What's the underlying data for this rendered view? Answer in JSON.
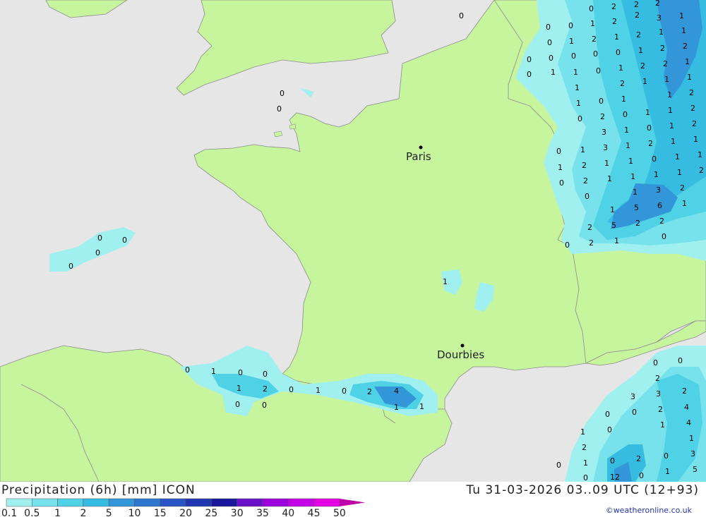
{
  "header": {
    "title": "Precipitation (6h) [mm] ICON",
    "datetime": "Tu 31-03-2026 03..09 UTC (12+93)",
    "credit": "©weatheronline.co.uk"
  },
  "cities": [
    {
      "name": "Paris"
    },
    {
      "name": "Dourbies"
    }
  ],
  "legend": {
    "labels": [
      "0.1",
      "0.5",
      "1",
      "2",
      "5",
      "10",
      "15",
      "20",
      "25",
      "30",
      "35",
      "40",
      "45",
      "50"
    ],
    "colors": [
      "#a0f0f0",
      "#78e2ec",
      "#50d2e6",
      "#36bce0",
      "#3296d8",
      "#2f76cf",
      "#2a55c6",
      "#1f36b0",
      "#18189c",
      "#6a10c8",
      "#9c00dc",
      "#c400e6",
      "#e400e4",
      "#c000a8"
    ]
  },
  "colors": {
    "sea": "#e6e6e6",
    "land": "#c6f59e",
    "border": "#8c8c8c"
  },
  "precip_values": [
    "0",
    "1",
    "2",
    "3",
    "4",
    "5",
    "6",
    "12"
  ]
}
